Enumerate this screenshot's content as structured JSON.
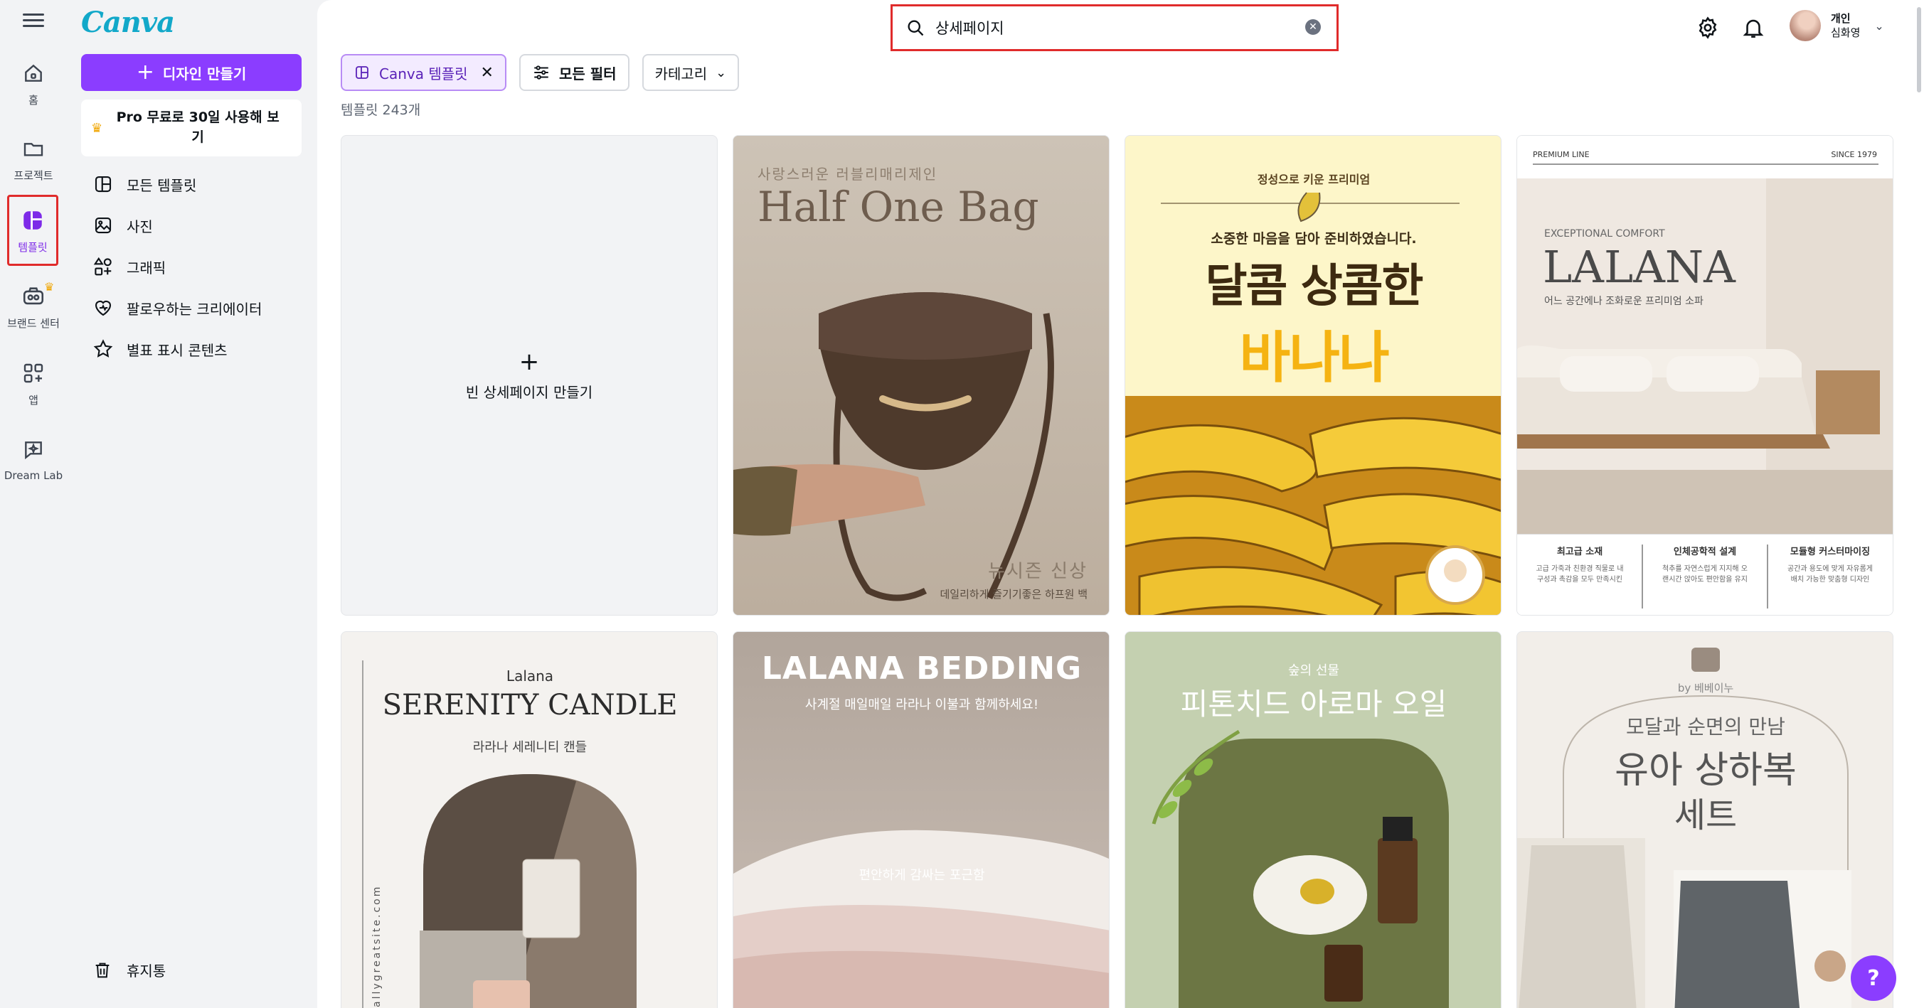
{
  "rail": {
    "items": [
      {
        "label": "홈",
        "icon": "home-icon"
      },
      {
        "label": "프로젝트",
        "icon": "folder-icon"
      },
      {
        "label": "템플릿",
        "icon": "templates-icon",
        "active": true
      },
      {
        "label": "브랜드 센터",
        "icon": "brand-icon"
      },
      {
        "label": "앱",
        "icon": "apps-icon"
      },
      {
        "label": "Dream Lab",
        "icon": "dream-lab-icon"
      }
    ]
  },
  "panel": {
    "logo": "Canva",
    "create_label": "디자인 만들기",
    "pro_label": "Pro 무료로 30일 사용해 보기",
    "nav": [
      {
        "label": "모든 템플릿",
        "icon": "all-templates-icon"
      },
      {
        "label": "사진",
        "icon": "photo-icon"
      },
      {
        "label": "그래픽",
        "icon": "graphics-icon"
      },
      {
        "label": "팔로우하는 크리에이터",
        "icon": "heart-icon"
      },
      {
        "label": "별표 표시 콘텐츠",
        "icon": "star-icon"
      }
    ],
    "trash_label": "휴지통"
  },
  "search": {
    "value": "상세페이지"
  },
  "user": {
    "line1": "개인",
    "line2": "심화영"
  },
  "filters": {
    "chip_canva": "Canva 템플릿",
    "chip_all": "모든 필터",
    "chip_category": "카테고리"
  },
  "result_count": "템플릿 243개",
  "blank_card_label": "빈 상세페이지 만들기",
  "cards": {
    "bag": {
      "tagline": "사랑스러운 러블리매리제인",
      "title": "Half One Bag",
      "subtitle": "뉴시즌 신상",
      "caption": "데일리하게 즐기기좋은 하프원 백"
    },
    "banana": {
      "tag": "정성으로 키운 프리미엄",
      "lead": "소중한 마음을 담아 준비하였습니다.",
      "title1": "달콤 상콤한",
      "title2": "바나나"
    },
    "lalana": {
      "top_left": "PREMIUM LINE",
      "top_right": "SINCE 1979",
      "kicker": "EXCEPTIONAL COMFORT",
      "title": "LALANA",
      "sub": "어느 공간에나 조화로운 프리미엄 소파",
      "features": [
        {
          "h": "최고급 소재",
          "d1": "고급 가죽과 친환경 직물로 내",
          "d2": "구성과 촉감을 모두 만족시킨"
        },
        {
          "h": "인체공학적 설계",
          "d1": "척추를 자연스럽게 지지해 오",
          "d2": "랜시간 앉아도 편안함을 유지"
        },
        {
          "h": "모듈형 커스터마이징",
          "d1": "공간과 용도에 맞게 자유롭게",
          "d2": "배치 가능한 맞춤형 디자인"
        }
      ]
    },
    "candle": {
      "brand": "Lalana",
      "title": "SERENITY CANDLE",
      "sub": "라라나 세레니티 캔들",
      "side": "reallygreatsite.com"
    },
    "bedding": {
      "title": "LALANA BEDDING",
      "sub": "사계절 매일매일 라라나 이불과 함께하세요!",
      "overlay": "편안하게 감싸는 포근함"
    },
    "oil": {
      "kicker": "숲의 선물",
      "title": "피톤치드 아로마 오일"
    },
    "baby": {
      "by": "by 베베이누",
      "sub": "모달과 순면의 만남",
      "title1": "유아 상하복",
      "title2": "세트"
    }
  },
  "colors": {
    "accent": "#8b3dff",
    "highlight": "#e02b2b"
  }
}
